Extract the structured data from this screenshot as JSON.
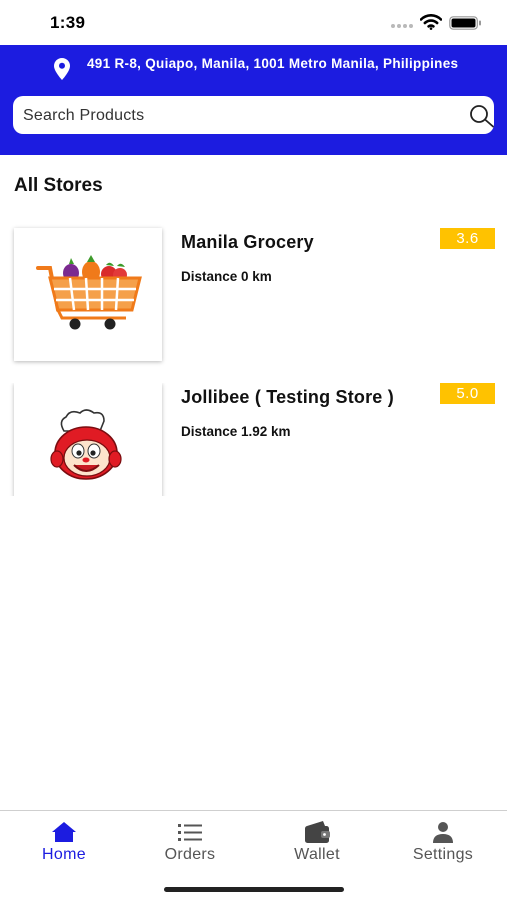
{
  "status_bar": {
    "time": "1:39"
  },
  "header": {
    "address": "491 R-8, Quiapo, Manila, 1001 Metro Manila, Philippines",
    "search": {
      "placeholder": "Search Products",
      "value": ""
    },
    "accent_color": "#1c1ce0"
  },
  "section_title": "All Stores",
  "stores": [
    {
      "name": "Manila Grocery",
      "distance": "Distance 0 km",
      "rating": "3.6",
      "thumbnail_icon": "shopping-cart-vegetables-icon"
    },
    {
      "name": "Jollibee ( Testing Store )",
      "distance": "Distance 1.92 km",
      "rating": "5.0",
      "thumbnail_icon": "jollibee-mascot-icon"
    }
  ],
  "rating_color": "#ffc200",
  "tabs": [
    {
      "label": "Home",
      "icon": "home-icon",
      "active": true
    },
    {
      "label": "Orders",
      "icon": "list-icon",
      "active": false
    },
    {
      "label": "Wallet",
      "icon": "wallet-icon",
      "active": false
    },
    {
      "label": "Settings",
      "icon": "person-icon",
      "active": false
    }
  ]
}
